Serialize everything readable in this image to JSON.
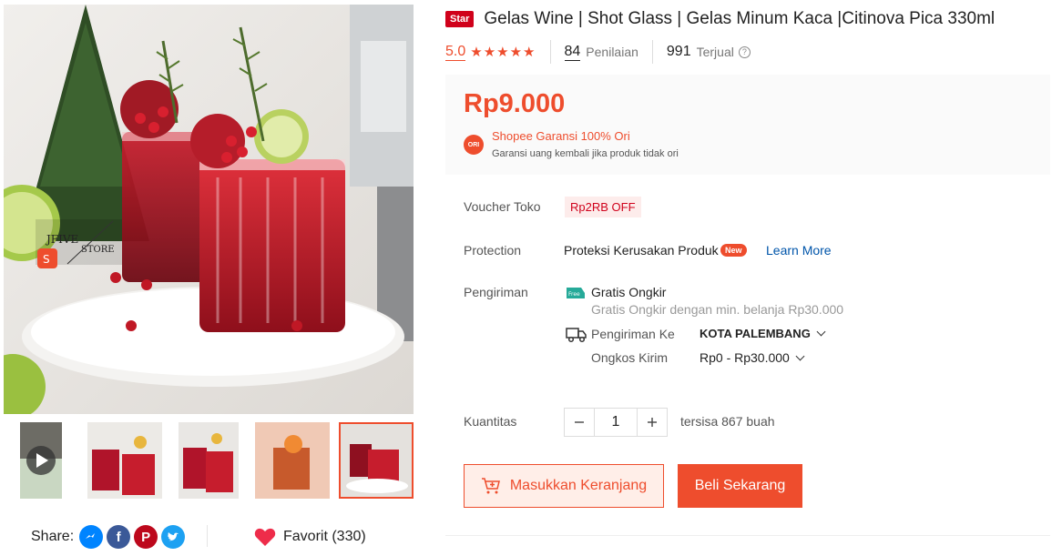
{
  "gallery": {
    "store_watermark_line1": "JFIVE",
    "store_watermark_line2": "STORE",
    "thumbnails": [
      {
        "name": "video"
      },
      {
        "name": "glasses-1"
      },
      {
        "name": "glasses-2"
      },
      {
        "name": "glass-orange"
      },
      {
        "name": "glasses-main",
        "active": true
      }
    ]
  },
  "share": {
    "label": "Share:"
  },
  "favorite": {
    "label": "Favorit (330)"
  },
  "product": {
    "badge": "Star",
    "title": "Gelas Wine | Shot Glass | Gelas Minum Kaca |Citinova Pica 330ml",
    "rating": "5.0",
    "stars": "★★★★★",
    "reviews_count": "84",
    "reviews_label": "Penilaian",
    "sold_count": "991",
    "sold_label": "Terjual",
    "price": "Rp9.000",
    "ori_badge": "ORI",
    "guarantee_title": "Shopee Garansi 100% Ori",
    "guarantee_sub": "Garansi uang kembali jika produk tidak ori"
  },
  "voucher": {
    "label": "Voucher Toko",
    "value": "Rp2RB OFF"
  },
  "protection": {
    "label": "Protection",
    "text": "Proteksi Kerusakan Produk",
    "badge": "New",
    "link": "Learn More"
  },
  "shipping": {
    "label": "Pengiriman",
    "free_icon_text": "Free",
    "free_title": "Gratis Ongkir",
    "free_sub": "Gratis Ongkir dengan min. belanja Rp30.000",
    "to_label": "Pengiriman Ke",
    "to_value": "KOTA PALEMBANG",
    "cost_label": "Ongkos Kirim",
    "cost_value": "Rp0 - Rp30.000"
  },
  "quantity": {
    "label": "Kuantitas",
    "value": "1",
    "stock": "tersisa 867 buah"
  },
  "actions": {
    "cart_label": "Masukkan Keranjang",
    "buy_label": "Beli Sekarang"
  },
  "colors": {
    "accent": "#ee4d2d",
    "star_badge": "#d0011b",
    "link": "#0055aa"
  }
}
